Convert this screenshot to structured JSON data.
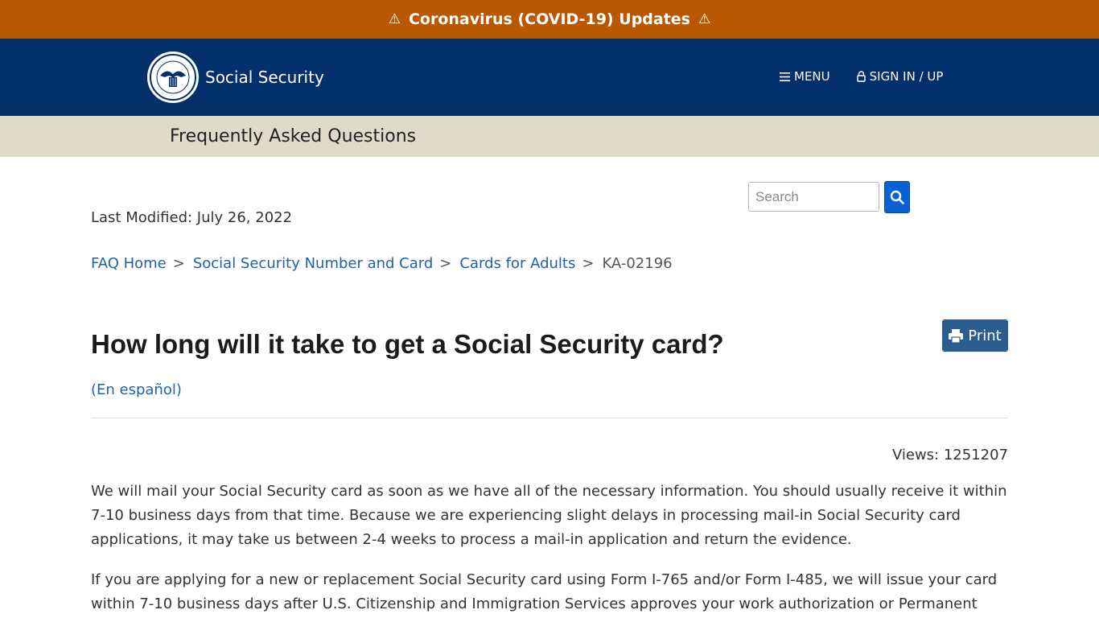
{
  "alert": {
    "text": "Coronavirus (COVID-19) Updates",
    "warn_glyph": "⚠"
  },
  "header": {
    "brand": "Social Security",
    "menu_label": "MENU",
    "signin_label": "SIGN IN / UP",
    "colors": {
      "header_bg": "#032f6a",
      "alert_bg": "#b95800",
      "subbar_bg": "#dfdbc8"
    }
  },
  "subbar": {
    "title": "Frequently Asked Questions"
  },
  "search": {
    "placeholder": "Search",
    "value": ""
  },
  "meta": {
    "last_modified": "Last Modified: July 26, 2022"
  },
  "breadcrumb": {
    "items": [
      "FAQ Home",
      "Social Security Number and Card",
      "Cards for Adults"
    ],
    "current": "KA-02196",
    "separator": ">"
  },
  "article": {
    "title": "How long will it take to get a Social Security card?",
    "espanol_link": "(En español)",
    "print_label": "Print",
    "views": "Views: 1251207",
    "paragraphs": [
      "We will mail your Social Security card as soon as we have all of the necessary information. You should usually receive it within 7-10 business days from that time. Because we are experiencing slight delays in processing mail-in Social Security card applications, it may take us between 2-4 weeks to process a mail-in application and return the evidence.",
      "If you are applying for a new or replacement Social Security card using Form I-765 and/or Form I-485, we will issue your card within 7-10 business days after U.S. Citizenship and Immigration Services approves your work authorization or Permanent"
    ]
  },
  "icons": [
    "warning-icon",
    "ssa-seal-logo",
    "hamburger-icon",
    "lock-icon",
    "search-icon",
    "printer-icon"
  ]
}
